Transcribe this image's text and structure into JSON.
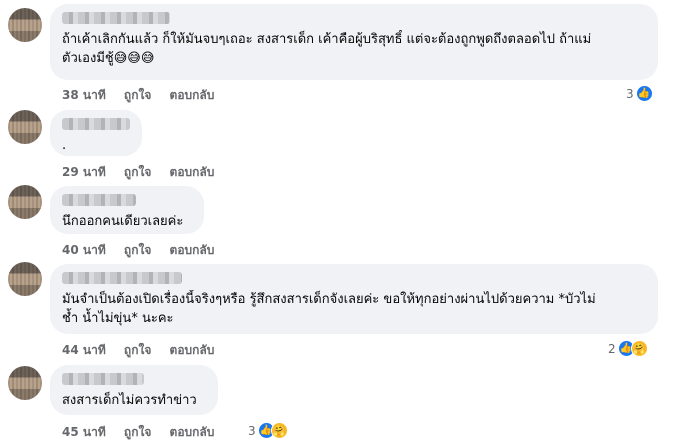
{
  "labels": {
    "like": "ถูกใจ",
    "reply": "ตอบกลับ"
  },
  "icons": {
    "like": "thumbs-up-icon",
    "care": "care-emoji-icon"
  },
  "colors": {
    "like_blue": "#1877f2",
    "bubble": "#f0f2f5",
    "meta": "#65676b"
  },
  "comments": [
    {
      "text_line1": "ถ้าเค้าเลิกกันแล้ว ก็ให้มันจบๆเถอะ สงสารเด็ก เค้าคือผู้บริสุทธิ์ แต่จะต้องถูกพูดถึงตลอดไป ถ้าแม่",
      "text_line2": "ตัวเองมีชู้",
      "emoji": "😅😅😅",
      "time": "38 นาที",
      "reaction_count": "3"
    },
    {
      "text_line1": ".",
      "time": "29 นาที"
    },
    {
      "text_line1": "นึกออกคนเดียวเลยค่ะ",
      "time": "40 นาที"
    },
    {
      "text_line1": "มันจำเป็นต้องเปิดเรื่องนี้จริงๆหรือ รู้สึกสงสารเด็กจังเลยค่ะ ขอให้ทุกอย่างผ่านไปด้วยความ *บัวไม่",
      "text_line2": "ช้ำ น้ำไม่ขุ่น* นะคะ",
      "time": "44 นาที",
      "reaction_count": "2"
    },
    {
      "text_line1": "สงสารเด็กไม่ควรทำข่าว",
      "time": "45 นาที",
      "reaction_count": "3"
    }
  ]
}
